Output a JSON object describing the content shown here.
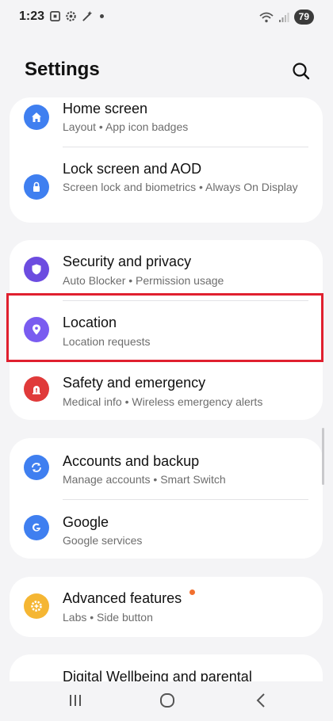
{
  "status_bar": {
    "time": "1:23",
    "battery": "79",
    "icons": [
      "screenshot-icon",
      "settings-gear-icon",
      "magic-wand-icon",
      "notification-dot-icon",
      "wifi-icon",
      "signal-icon"
    ]
  },
  "header": {
    "title": "Settings",
    "search_icon": "search-icon"
  },
  "cards": [
    {
      "items": [
        {
          "title": "Home screen",
          "subtitle": "Layout  •  App icon badges",
          "icon": "home-icon",
          "icon_color": "#3f7ff0"
        },
        {
          "title": "Lock screen and AOD",
          "subtitle": "Screen lock and biometrics  •  Always On Display",
          "icon": "lock-icon",
          "icon_color": "#3f7ff0"
        }
      ]
    },
    {
      "items": [
        {
          "title": "Security and privacy",
          "subtitle": "Auto Blocker  •  Permission usage",
          "icon": "shield-icon",
          "icon_color": "#6c4ce0"
        },
        {
          "title": "Location",
          "subtitle": "Location requests",
          "icon": "location-pin-icon",
          "icon_color": "#7a5cf0",
          "highlighted": true
        },
        {
          "title": "Safety and emergency",
          "subtitle": "Medical info  •  Wireless emergency alerts",
          "icon": "emergency-alert-icon",
          "icon_color": "#e03a3a"
        }
      ]
    },
    {
      "items": [
        {
          "title": "Accounts and backup",
          "subtitle": "Manage accounts  •  Smart Switch",
          "icon": "sync-icon",
          "icon_color": "#3f7ff0"
        },
        {
          "title": "Google",
          "subtitle": "Google services",
          "icon": "google-icon",
          "icon_color": "#3f7ff0"
        }
      ]
    },
    {
      "items": [
        {
          "title": "Advanced features",
          "subtitle": "Labs  •  Side button",
          "icon": "gear-plus-icon",
          "icon_color": "#f5b633",
          "badge": "orange-dot"
        }
      ]
    },
    {
      "items": [
        {
          "title": "Digital Wellbeing and parental",
          "subtitle": "",
          "icon": "",
          "icon_color": ""
        }
      ]
    }
  ],
  "navbar": {
    "recents_icon": "recents-icon",
    "home_icon": "home-circle-icon",
    "back_icon": "back-chevron-icon"
  }
}
